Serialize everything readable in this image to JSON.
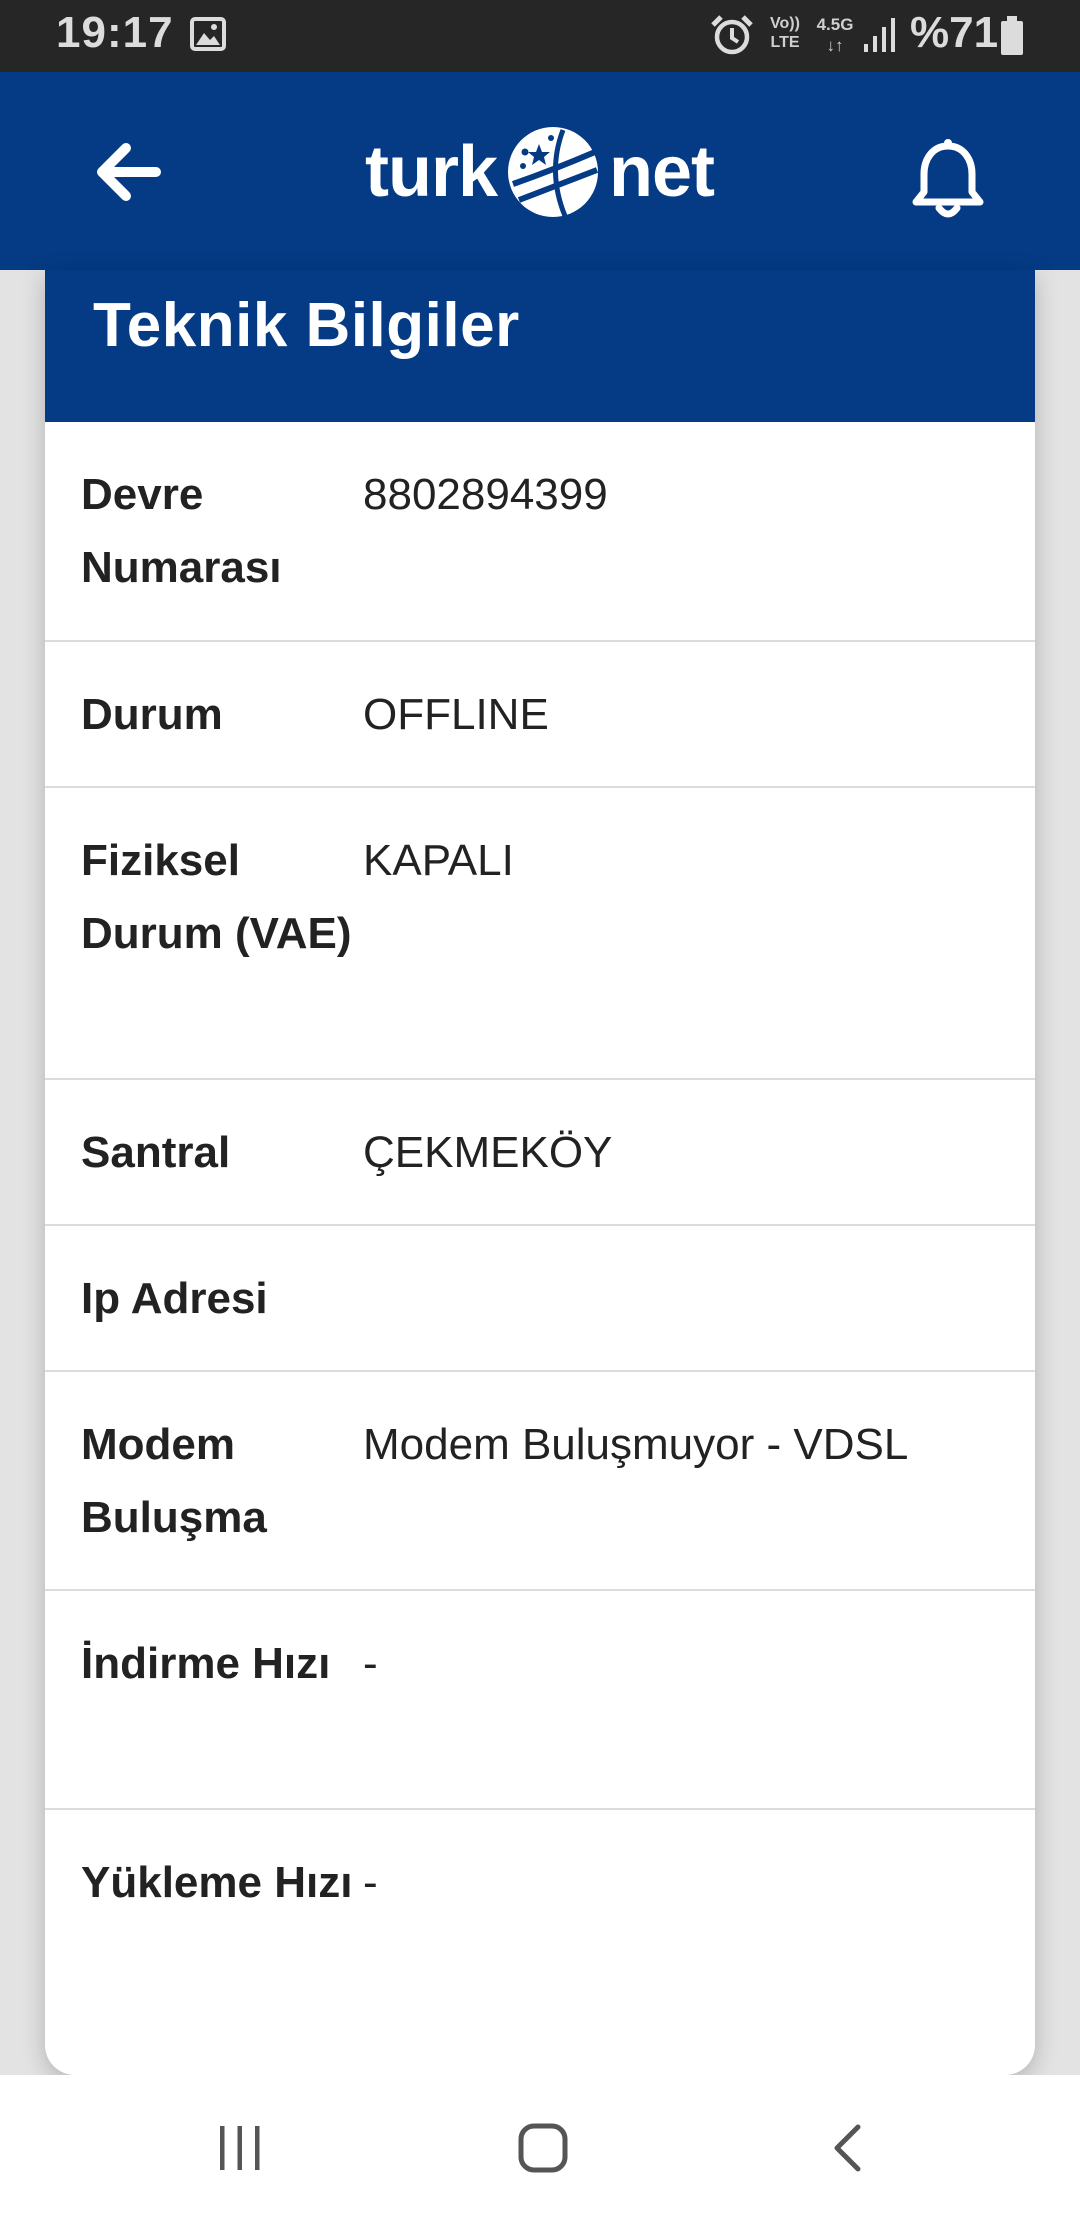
{
  "status_bar": {
    "time": "19:17",
    "volte_label_top": "Vo))",
    "volte_label_bottom": "LTE",
    "network_type": "4.5G",
    "battery_percent": "%71",
    "icons": [
      "gallery-icon",
      "alarm-icon",
      "signal-icon",
      "battery-icon"
    ]
  },
  "app_bar": {
    "brand_left": "turk",
    "brand_right": "net",
    "icons": [
      "back-arrow-icon",
      "bell-icon"
    ],
    "background_color": "#043b84"
  },
  "card": {
    "title": "Teknik Bilgiler",
    "rows": [
      {
        "label": "Devre Numarası",
        "value": "8802894399"
      },
      {
        "label": "Durum",
        "value": "OFFLINE"
      },
      {
        "label": "Fiziksel Durum (VAE)",
        "value": "KAPALI"
      },
      {
        "label": "Santral",
        "value": "ÇEKMEKÖY"
      },
      {
        "label": "Ip Adresi",
        "value": ""
      },
      {
        "label": "Modem Buluşma",
        "value": "Modem Buluşmuyor - VDSL"
      },
      {
        "label": "İndirme Hızı",
        "value": "-"
      },
      {
        "label": "Yükleme Hızı",
        "value": "-"
      }
    ]
  },
  "nav_bar": {
    "icons": [
      "recents-icon",
      "home-icon",
      "back-icon"
    ]
  }
}
